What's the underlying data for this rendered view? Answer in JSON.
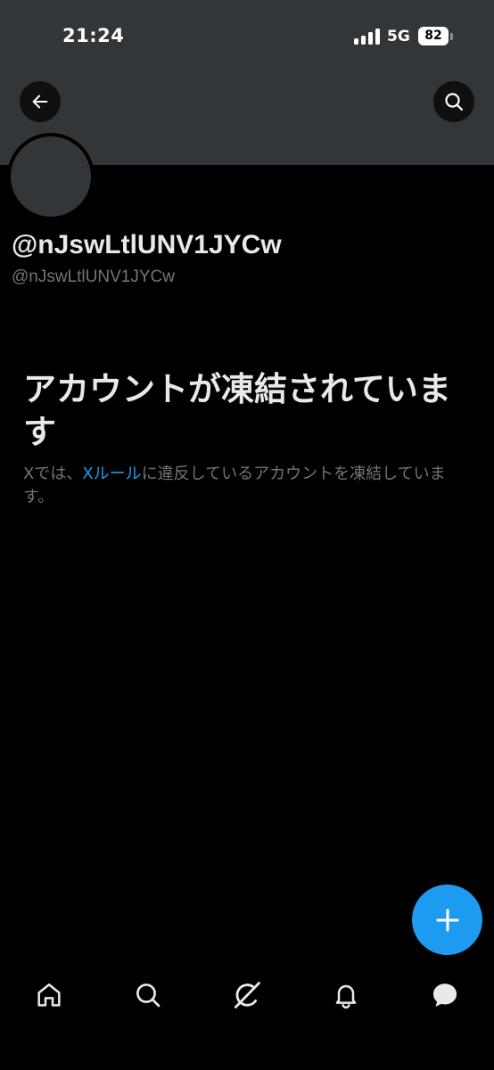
{
  "status_bar": {
    "time": "21:24",
    "network": "5G",
    "battery": "82"
  },
  "profile": {
    "display_name": "@nJswLtlUNV1JYCw",
    "handle": "@nJswLtlUNV1JYCw"
  },
  "notice": {
    "title": "アカウントが凍結されています",
    "desc_prefix": "Xでは、",
    "rules_link": "Xルール",
    "desc_suffix": "に違反しているアカウントを凍結しています。"
  },
  "nav": {
    "items": [
      "home",
      "search",
      "grok",
      "notifications",
      "messages"
    ]
  },
  "colors": {
    "accent": "#1d9bf0",
    "banner": "#333639",
    "text_primary": "#e7e9ea",
    "text_secondary": "#71767b",
    "background": "#000000"
  },
  "icons": [
    "back-arrow-icon",
    "search-icon",
    "plus-icon",
    "home-icon",
    "search-icon",
    "grok-icon",
    "bell-icon",
    "message-icon"
  ]
}
